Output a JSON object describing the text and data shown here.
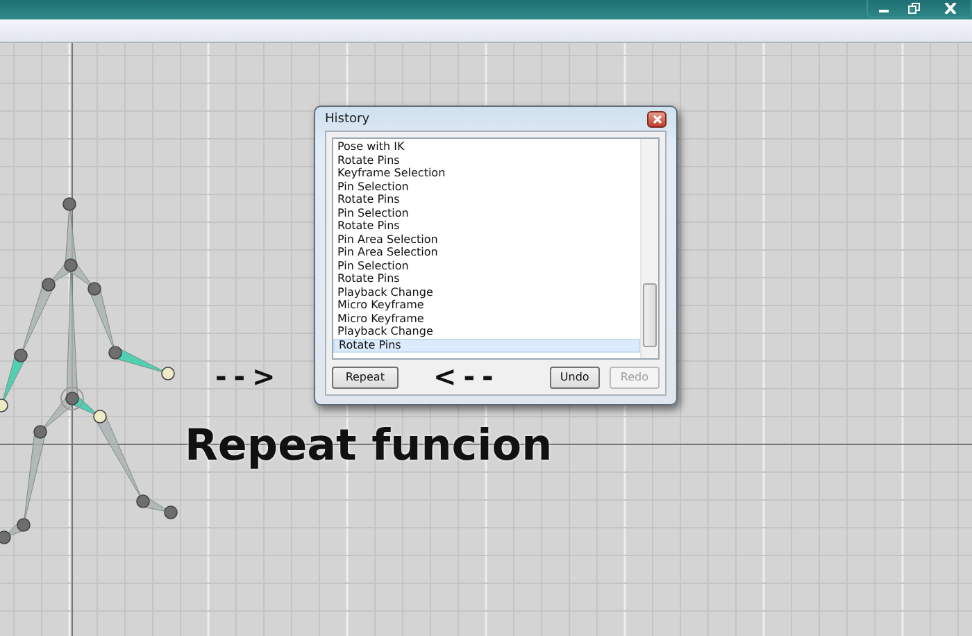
{
  "history_dialog": {
    "title": "History",
    "items": [
      {
        "label": "Pose with IK",
        "selected": false
      },
      {
        "label": "Rotate Pins",
        "selected": false
      },
      {
        "label": "Keyframe Selection",
        "selected": false
      },
      {
        "label": "Pin Selection",
        "selected": false
      },
      {
        "label": "Rotate Pins",
        "selected": false
      },
      {
        "label": "Pin Selection",
        "selected": false
      },
      {
        "label": "Rotate Pins",
        "selected": false
      },
      {
        "label": "Pin Area Selection",
        "selected": false
      },
      {
        "label": "Pin Area Selection",
        "selected": false
      },
      {
        "label": "Pin Selection",
        "selected": false
      },
      {
        "label": "Rotate Pins",
        "selected": false
      },
      {
        "label": "Playback Change",
        "selected": false
      },
      {
        "label": "Micro Keyframe",
        "selected": false
      },
      {
        "label": "Micro Keyframe",
        "selected": false
      },
      {
        "label": "Playback Change",
        "selected": false
      },
      {
        "label": "Rotate Pins",
        "selected": true
      }
    ],
    "buttons": [
      {
        "label": "Repeat",
        "disabled": false
      },
      {
        "label": "Undo",
        "disabled": false
      },
      {
        "label": "Redo",
        "disabled": true
      }
    ]
  },
  "annotations": [
    {
      "kind": "arrow-right",
      "text": "- - >"
    },
    {
      "kind": "arrow-left",
      "text": "< - -"
    },
    {
      "kind": "caption",
      "text": "Repeat funcion"
    }
  ]
}
